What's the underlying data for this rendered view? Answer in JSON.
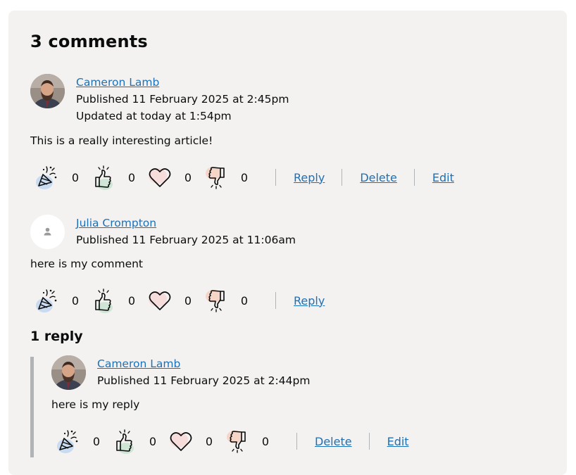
{
  "heading": "3 comments",
  "comments": [
    {
      "author": "Cameron Lamb",
      "published": "Published 11 February 2025 at 2:45pm",
      "updated": "Updated at today at 1:54pm",
      "text": "This is a really interesting article!",
      "reactions": {
        "celebrate": "0",
        "like": "0",
        "love": "0",
        "dislike": "0"
      },
      "actions": {
        "reply": "Reply",
        "delete": "Delete",
        "edit": "Edit"
      }
    },
    {
      "author": "Julia Crompton",
      "published": "Published 11 February 2025 at 11:06am",
      "text": "here is my comment",
      "reactions": {
        "celebrate": "0",
        "like": "0",
        "love": "0",
        "dislike": "0"
      },
      "actions": {
        "reply": "Reply"
      }
    }
  ],
  "replies": {
    "title": "1 reply",
    "items": [
      {
        "author": "Cameron Lamb",
        "published": "Published 11 February 2025 at 2:44pm",
        "text": "here is my reply",
        "reactions": {
          "celebrate": "0",
          "like": "0",
          "love": "0",
          "dislike": "0"
        },
        "actions": {
          "delete": "Delete",
          "edit": "Edit"
        }
      }
    ]
  },
  "icons": {
    "celebrate": "party-popper-icon",
    "like": "thumbs-up-icon",
    "love": "heart-icon",
    "dislike": "thumbs-down-icon",
    "default_avatar": "person-icon"
  },
  "colors": {
    "panel_bg": "#f3f2f1",
    "link": "#1d70b8",
    "text": "#0b0c0c",
    "separator": "#b1b4b6",
    "celebrate_blob": "#c9dbf1",
    "like_blob": "#cfe6d6",
    "love_blob": "#f7dcdc",
    "dislike_blob": "#f6d5c9"
  }
}
